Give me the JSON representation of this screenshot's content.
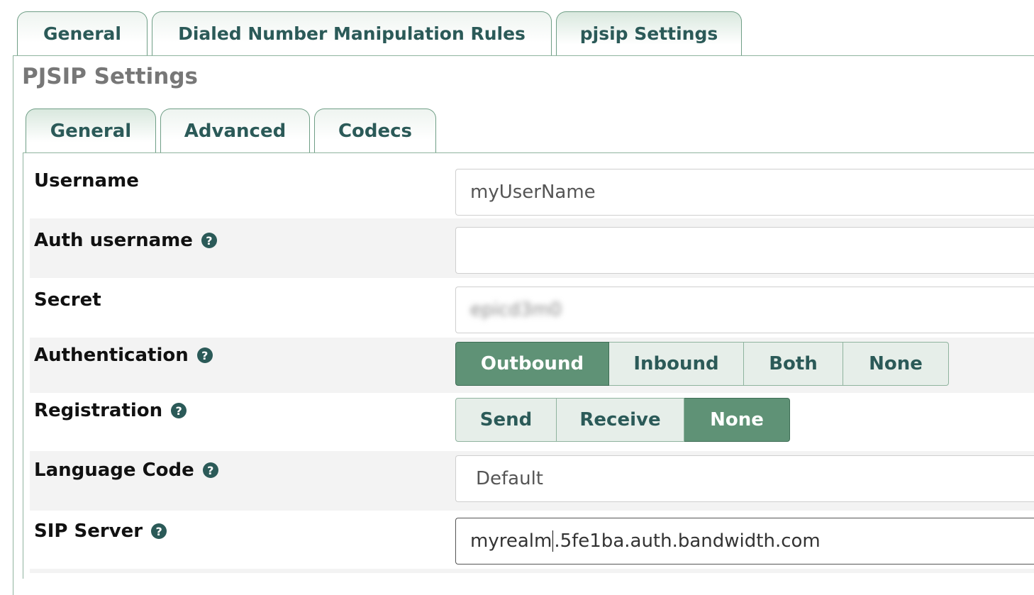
{
  "top_tabs": [
    "General",
    "Dialed Number Manipulation Rules",
    "pjsip Settings"
  ],
  "section_title": "PJSIP Settings",
  "inner_tabs": [
    "General",
    "Advanced",
    "Codecs"
  ],
  "fields": {
    "username": {
      "label": "Username",
      "value": "myUserName"
    },
    "auth_username": {
      "label": "Auth username",
      "value": ""
    },
    "secret": {
      "label": "Secret",
      "value": "epicd3m0"
    },
    "authentication": {
      "label": "Authentication",
      "options": [
        "Outbound",
        "Inbound",
        "Both",
        "None"
      ],
      "selected": "Outbound"
    },
    "registration": {
      "label": "Registration",
      "options": [
        "Send",
        "Receive",
        "None"
      ],
      "selected": "None"
    },
    "language_code": {
      "label": "Language Code",
      "value": "Default"
    },
    "sip_server": {
      "label": "SIP Server",
      "value_before_cursor": "myrealm",
      "value_after_cursor": ".5fe1ba.auth.bandwidth.com"
    }
  },
  "help_glyph": "?",
  "colors": {
    "accent": "#5f9276",
    "tab_text": "#2b5a58",
    "row_shade": "#f3f3f3"
  }
}
